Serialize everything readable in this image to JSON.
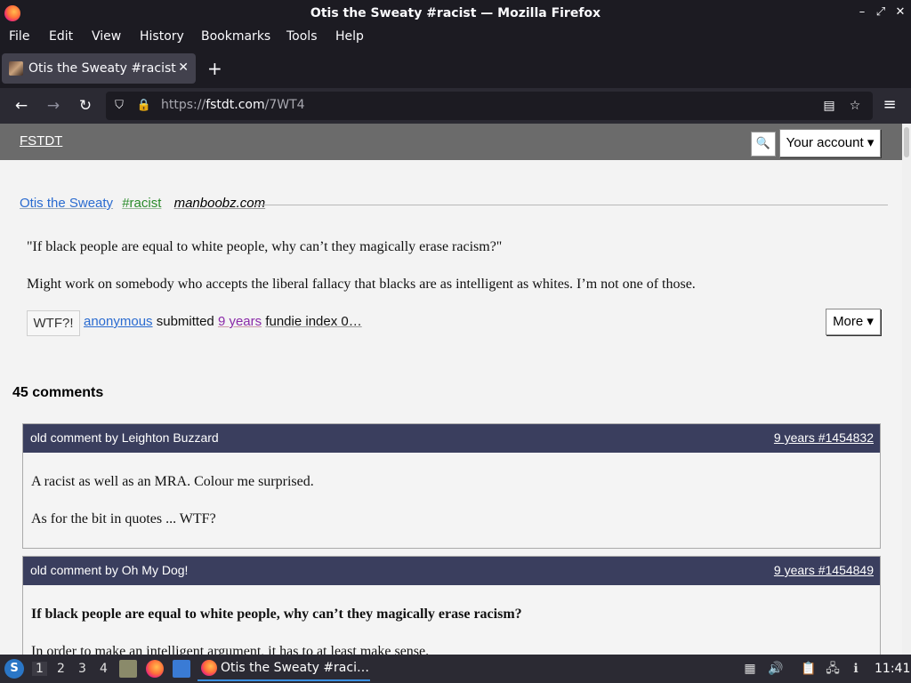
{
  "window": {
    "title": "Otis the Sweaty #racist — Mozilla Firefox"
  },
  "menu": [
    "File",
    "Edit",
    "View",
    "History",
    "Bookmarks",
    "Tools",
    "Help"
  ],
  "tab": {
    "label": "Otis the Sweaty #racist"
  },
  "navbar": {
    "url_proto": "https://",
    "url_host": "fstdt.com",
    "url_path": "/7WT4"
  },
  "site": {
    "brand": "FSTDT",
    "account_label": "Your account ▾"
  },
  "quote": {
    "author": "Otis the Sweaty",
    "tag": "#racist",
    "source": "manboobz.com",
    "paragraphs": [
      "\"If black people are equal to white people, why can’t they magically erase racism?\"",
      "Might work on somebody who accepts the liberal fallacy that blacks are as intelligent as whites. I’m not one of those."
    ],
    "vote_label": "WTF?!",
    "submitter": "anonymous",
    "submitted_text": "submitted",
    "age": "9 years",
    "fundie_index": "fundie index 0…",
    "more_label": "More ▾"
  },
  "comments_heading": "45 comments",
  "comments": [
    {
      "by": "old comment by Leighton Buzzard",
      "meta": "9 years #1454832",
      "paragraphs": [
        "A racist as well as an MRA. Colour me surprised.",
        "As for the bit in quotes ... WTF?"
      ]
    },
    {
      "by": "old comment by Oh My Dog!",
      "meta": "9 years #1454849",
      "paragraphs": [
        "If black people are equal to white people, why can’t they magically erase racism?",
        "In order to make an intelligent argument, it has to at least make sense."
      ]
    }
  ],
  "taskbar": {
    "workspaces": [
      "1",
      "2",
      "3",
      "4"
    ],
    "task_label": "Otis the Sweaty #raci…",
    "clock": "11:41"
  }
}
